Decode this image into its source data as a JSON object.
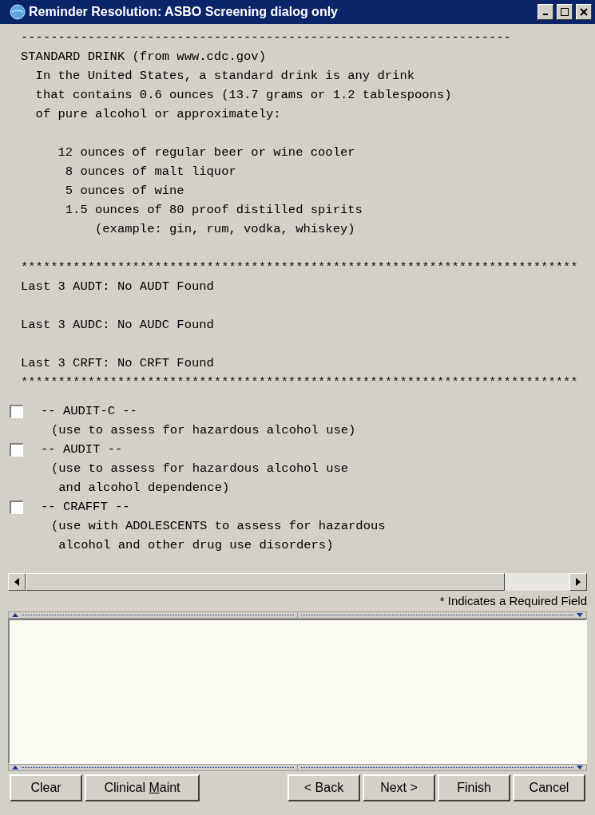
{
  "window": {
    "title": "Reminder Resolution: ASBO Screening dialog only"
  },
  "content": {
    "rule_top": "------------------------------------------------------------------",
    "heading": "STANDARD DRINK (from www.cdc.gov)",
    "intro": [
      "  In the United States, a standard drink is any drink",
      "  that contains 0.6 ounces (13.7 grams or 1.2 tablespoons)",
      "  of pure alcohol or approximately:"
    ],
    "servings": [
      "     12 ounces of regular beer or wine cooler",
      "      8 ounces of malt liquor",
      "      5 ounces of wine",
      "      1.5 ounces of 80 proof distilled spirits",
      "          (example: gin, rum, vodka, whiskey)"
    ],
    "rule_stars": "***************************************************************************",
    "history": [
      "Last 3 AUDT: No AUDT Found",
      "Last 3 AUDC: No AUDC Found",
      "Last 3 CRFT: No CRFT Found"
    ],
    "rule_stars_bottom": "***************************************************************************",
    "items": [
      {
        "title": "-- AUDIT-C --",
        "checked": false,
        "description": [
          "(use to assess for hazardous alcohol use)"
        ]
      },
      {
        "title": "-- AUDIT --",
        "checked": false,
        "description": [
          "(use to assess for hazardous alcohol use",
          " and alcohol dependence)"
        ]
      },
      {
        "title": "-- CRAFFT --",
        "checked": false,
        "description": [
          "(use with ADOLESCENTS to assess for hazardous",
          " alcohol and other drug use disorders)"
        ]
      }
    ]
  },
  "required_note": "* Indicates a Required Field",
  "buttons_left": [
    {
      "label": "Clear"
    },
    {
      "label_before": "Clinical ",
      "mnemonic": "M",
      "label_after": "aint"
    }
  ],
  "buttons_right": [
    {
      "label": "< Back"
    },
    {
      "label": "Next >"
    },
    {
      "label": "Finish"
    },
    {
      "label": "Cancel"
    }
  ]
}
